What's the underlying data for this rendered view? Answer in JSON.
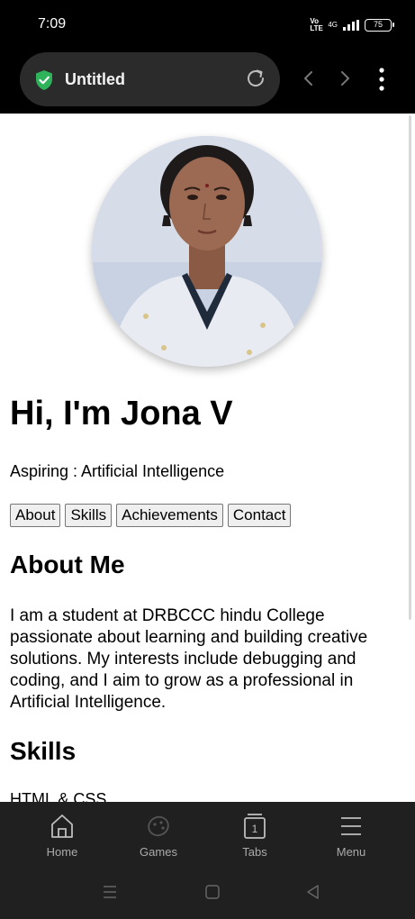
{
  "status": {
    "time": "7:09",
    "volte": "Vo LTE",
    "network": "4G",
    "battery": "75"
  },
  "browser": {
    "tab_title": "Untitled",
    "shield_color": "#2fb35a"
  },
  "page": {
    "heading": "Hi, I'm Jona V",
    "tagline": "Aspiring : Artificial Intelligence",
    "nav_buttons": [
      "About",
      "Skills",
      "Achievements",
      "Contact"
    ],
    "about_title": "About Me",
    "about_text": "I am a student at DRBCCC hindu College passionate about learning and building creative solutions. My interests include debugging and coding, and I aim to grow as a professional in Artificial Intelligence.",
    "skills_title": "Skills",
    "skills_first": "HTML & CSS"
  },
  "bottom_nav": [
    {
      "label": "Home",
      "icon": "home-icon"
    },
    {
      "label": "Games",
      "icon": "gamepad-icon"
    },
    {
      "label": "Tabs",
      "icon": "tabs-icon",
      "count": "1"
    },
    {
      "label": "Menu",
      "icon": "menu-icon"
    }
  ]
}
